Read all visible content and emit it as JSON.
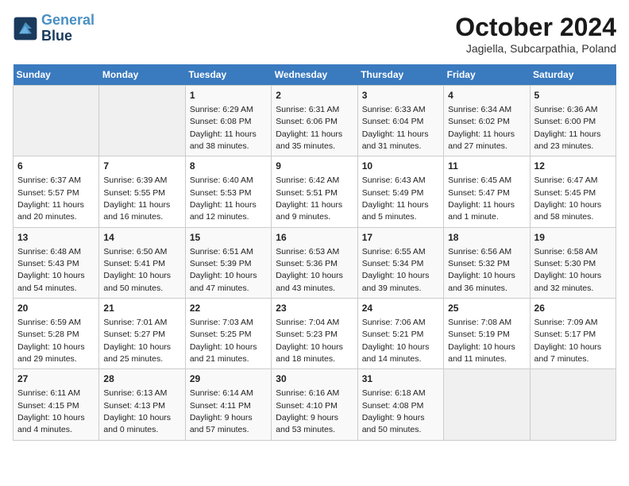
{
  "logo": {
    "line1": "General",
    "line2": "Blue"
  },
  "title": "October 2024",
  "subtitle": "Jagiella, Subcarpathia, Poland",
  "days_of_week": [
    "Sunday",
    "Monday",
    "Tuesday",
    "Wednesday",
    "Thursday",
    "Friday",
    "Saturday"
  ],
  "weeks": [
    [
      {
        "num": "",
        "sunrise": "",
        "sunset": "",
        "daylight": ""
      },
      {
        "num": "",
        "sunrise": "",
        "sunset": "",
        "daylight": ""
      },
      {
        "num": "1",
        "sunrise": "Sunrise: 6:29 AM",
        "sunset": "Sunset: 6:08 PM",
        "daylight": "Daylight: 11 hours and 38 minutes."
      },
      {
        "num": "2",
        "sunrise": "Sunrise: 6:31 AM",
        "sunset": "Sunset: 6:06 PM",
        "daylight": "Daylight: 11 hours and 35 minutes."
      },
      {
        "num": "3",
        "sunrise": "Sunrise: 6:33 AM",
        "sunset": "Sunset: 6:04 PM",
        "daylight": "Daylight: 11 hours and 31 minutes."
      },
      {
        "num": "4",
        "sunrise": "Sunrise: 6:34 AM",
        "sunset": "Sunset: 6:02 PM",
        "daylight": "Daylight: 11 hours and 27 minutes."
      },
      {
        "num": "5",
        "sunrise": "Sunrise: 6:36 AM",
        "sunset": "Sunset: 6:00 PM",
        "daylight": "Daylight: 11 hours and 23 minutes."
      }
    ],
    [
      {
        "num": "6",
        "sunrise": "Sunrise: 6:37 AM",
        "sunset": "Sunset: 5:57 PM",
        "daylight": "Daylight: 11 hours and 20 minutes."
      },
      {
        "num": "7",
        "sunrise": "Sunrise: 6:39 AM",
        "sunset": "Sunset: 5:55 PM",
        "daylight": "Daylight: 11 hours and 16 minutes."
      },
      {
        "num": "8",
        "sunrise": "Sunrise: 6:40 AM",
        "sunset": "Sunset: 5:53 PM",
        "daylight": "Daylight: 11 hours and 12 minutes."
      },
      {
        "num": "9",
        "sunrise": "Sunrise: 6:42 AM",
        "sunset": "Sunset: 5:51 PM",
        "daylight": "Daylight: 11 hours and 9 minutes."
      },
      {
        "num": "10",
        "sunrise": "Sunrise: 6:43 AM",
        "sunset": "Sunset: 5:49 PM",
        "daylight": "Daylight: 11 hours and 5 minutes."
      },
      {
        "num": "11",
        "sunrise": "Sunrise: 6:45 AM",
        "sunset": "Sunset: 5:47 PM",
        "daylight": "Daylight: 11 hours and 1 minute."
      },
      {
        "num": "12",
        "sunrise": "Sunrise: 6:47 AM",
        "sunset": "Sunset: 5:45 PM",
        "daylight": "Daylight: 10 hours and 58 minutes."
      }
    ],
    [
      {
        "num": "13",
        "sunrise": "Sunrise: 6:48 AM",
        "sunset": "Sunset: 5:43 PM",
        "daylight": "Daylight: 10 hours and 54 minutes."
      },
      {
        "num": "14",
        "sunrise": "Sunrise: 6:50 AM",
        "sunset": "Sunset: 5:41 PM",
        "daylight": "Daylight: 10 hours and 50 minutes."
      },
      {
        "num": "15",
        "sunrise": "Sunrise: 6:51 AM",
        "sunset": "Sunset: 5:39 PM",
        "daylight": "Daylight: 10 hours and 47 minutes."
      },
      {
        "num": "16",
        "sunrise": "Sunrise: 6:53 AM",
        "sunset": "Sunset: 5:36 PM",
        "daylight": "Daylight: 10 hours and 43 minutes."
      },
      {
        "num": "17",
        "sunrise": "Sunrise: 6:55 AM",
        "sunset": "Sunset: 5:34 PM",
        "daylight": "Daylight: 10 hours and 39 minutes."
      },
      {
        "num": "18",
        "sunrise": "Sunrise: 6:56 AM",
        "sunset": "Sunset: 5:32 PM",
        "daylight": "Daylight: 10 hours and 36 minutes."
      },
      {
        "num": "19",
        "sunrise": "Sunrise: 6:58 AM",
        "sunset": "Sunset: 5:30 PM",
        "daylight": "Daylight: 10 hours and 32 minutes."
      }
    ],
    [
      {
        "num": "20",
        "sunrise": "Sunrise: 6:59 AM",
        "sunset": "Sunset: 5:28 PM",
        "daylight": "Daylight: 10 hours and 29 minutes."
      },
      {
        "num": "21",
        "sunrise": "Sunrise: 7:01 AM",
        "sunset": "Sunset: 5:27 PM",
        "daylight": "Daylight: 10 hours and 25 minutes."
      },
      {
        "num": "22",
        "sunrise": "Sunrise: 7:03 AM",
        "sunset": "Sunset: 5:25 PM",
        "daylight": "Daylight: 10 hours and 21 minutes."
      },
      {
        "num": "23",
        "sunrise": "Sunrise: 7:04 AM",
        "sunset": "Sunset: 5:23 PM",
        "daylight": "Daylight: 10 hours and 18 minutes."
      },
      {
        "num": "24",
        "sunrise": "Sunrise: 7:06 AM",
        "sunset": "Sunset: 5:21 PM",
        "daylight": "Daylight: 10 hours and 14 minutes."
      },
      {
        "num": "25",
        "sunrise": "Sunrise: 7:08 AM",
        "sunset": "Sunset: 5:19 PM",
        "daylight": "Daylight: 10 hours and 11 minutes."
      },
      {
        "num": "26",
        "sunrise": "Sunrise: 7:09 AM",
        "sunset": "Sunset: 5:17 PM",
        "daylight": "Daylight: 10 hours and 7 minutes."
      }
    ],
    [
      {
        "num": "27",
        "sunrise": "Sunrise: 6:11 AM",
        "sunset": "Sunset: 4:15 PM",
        "daylight": "Daylight: 10 hours and 4 minutes."
      },
      {
        "num": "28",
        "sunrise": "Sunrise: 6:13 AM",
        "sunset": "Sunset: 4:13 PM",
        "daylight": "Daylight: 10 hours and 0 minutes."
      },
      {
        "num": "29",
        "sunrise": "Sunrise: 6:14 AM",
        "sunset": "Sunset: 4:11 PM",
        "daylight": "Daylight: 9 hours and 57 minutes."
      },
      {
        "num": "30",
        "sunrise": "Sunrise: 6:16 AM",
        "sunset": "Sunset: 4:10 PM",
        "daylight": "Daylight: 9 hours and 53 minutes."
      },
      {
        "num": "31",
        "sunrise": "Sunrise: 6:18 AM",
        "sunset": "Sunset: 4:08 PM",
        "daylight": "Daylight: 9 hours and 50 minutes."
      },
      {
        "num": "",
        "sunrise": "",
        "sunset": "",
        "daylight": ""
      },
      {
        "num": "",
        "sunrise": "",
        "sunset": "",
        "daylight": ""
      }
    ]
  ]
}
